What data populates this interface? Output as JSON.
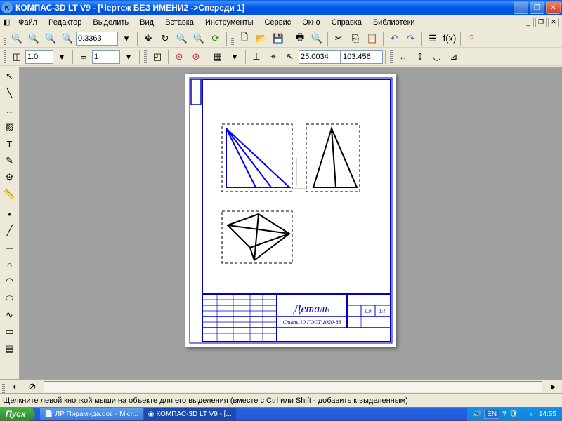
{
  "title": "КОМПАС-3D LT V9 - [Чертеж БЕЗ ИМЕНИ2 ->Спереди 1]",
  "menu": [
    "Файл",
    "Редактор",
    "Выделить",
    "Вид",
    "Вставка",
    "Инструменты",
    "Сервис",
    "Окно",
    "Справка",
    "Библиотеки"
  ],
  "toolbar1": {
    "zoom": "0.3363"
  },
  "toolbar2": {
    "scale": "1.0",
    "layer": "1",
    "coord_x": "25.0034",
    "coord_y": "103.456"
  },
  "stamp": {
    "title": "Деталь",
    "material": "Сталь 10  ГОСТ 1050-88",
    "col1": "0,9",
    "col2": "1:1"
  },
  "status_hint": "Щелкните левой кнопкой мыши на объекте для его выделения (вместе с Ctrl или Shift - добавить к выделенным)",
  "taskbar": {
    "start": "Пуск",
    "tasks": [
      "ЛР Пирамида.doc - Micr...",
      "КОМПАС-3D LT V9 - [..."
    ],
    "lang": "EN",
    "time": "14:55"
  }
}
